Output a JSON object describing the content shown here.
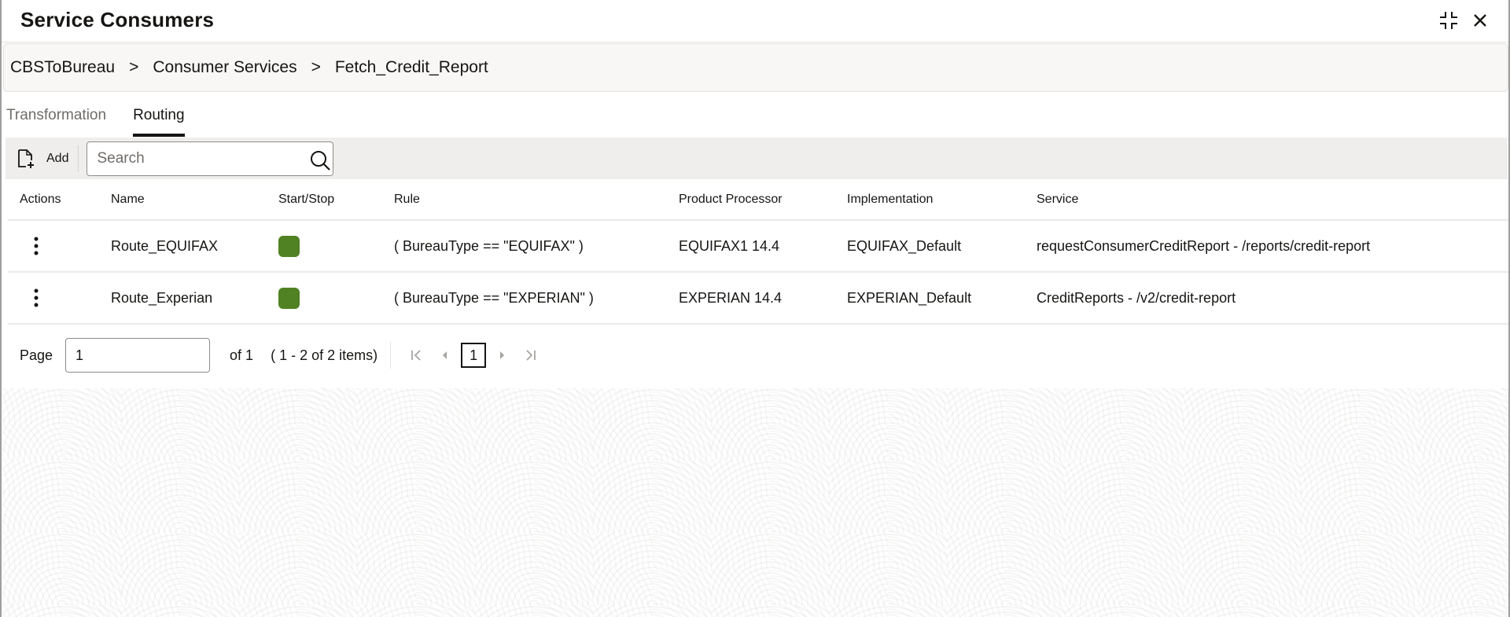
{
  "header": {
    "title": "Service Consumers",
    "icons": {
      "compress": "compress-icon",
      "close": "close-icon"
    }
  },
  "breadcrumb": {
    "items": [
      "CBSToBureau",
      "Consumer Services",
      "Fetch_Credit_Report"
    ],
    "separator": ">"
  },
  "tabs": [
    {
      "label": "Transformation",
      "active": false
    },
    {
      "label": "Routing",
      "active": true
    }
  ],
  "toolbar": {
    "add_label": "Add",
    "add_icon": "add-document-icon",
    "search": {
      "placeholder": "Search",
      "value": "",
      "icon": "search-icon"
    }
  },
  "table": {
    "columns": [
      "Actions",
      "Name",
      "Start/Stop",
      "Rule",
      "Product Processor",
      "Implementation",
      "Service"
    ],
    "rows": [
      {
        "name": "Route_EQUIFAX",
        "status": "started",
        "status_color": "#508223",
        "rule": "( BureauType == \"EQUIFAX\" )",
        "product_processor": "EQUIFAX1 14.4",
        "implementation": "EQUIFAX_Default",
        "service": "requestConsumerCreditReport - /reports/credit-report"
      },
      {
        "name": "Route_Experian",
        "status": "started",
        "status_color": "#508223",
        "rule": "( BureauType == \"EXPERIAN\" )",
        "product_processor": "EXPERIAN 14.4",
        "implementation": "EXPERIAN_Default",
        "service": "CreditReports - /v2/credit-report"
      }
    ]
  },
  "pagination": {
    "page_label": "Page",
    "page_value": "1",
    "of_label": "of 1",
    "range_label": "( 1 - 2 of 2 items)",
    "current_page": "1"
  }
}
